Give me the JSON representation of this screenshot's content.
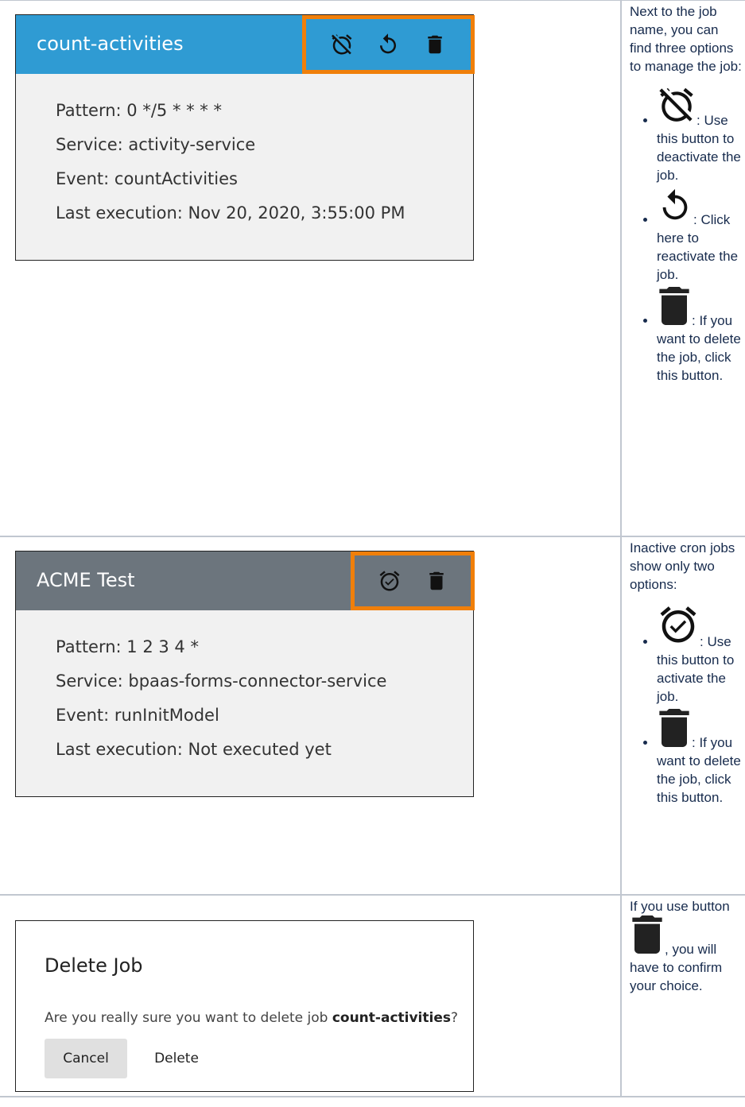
{
  "job1": {
    "name": "count-activities",
    "header_color": "#2f9bd3",
    "lines": [
      "Pattern: 0 */5 * * * *",
      "Service: activity-service",
      "Event: countActivities",
      "Last execution: Nov 20, 2020, 3:55:00 PM"
    ],
    "icons": [
      "alarm-off-icon",
      "restore-icon",
      "delete-icon"
    ]
  },
  "desc1": {
    "intro": "Next to the job name, you can find three options to manage the job:",
    "items": [
      ": Use this button to deactivate the job.",
      ": Click here to reactivate the job.",
      ": If you want to delete the job, click this button."
    ]
  },
  "job2": {
    "name": "ACME Test",
    "header_color": "#6c757d",
    "lines": [
      "Pattern: 1 2 3 4 *",
      "Service: bpaas-forms-connector-service",
      "Event: runInitModel",
      "Last execution: Not executed yet"
    ],
    "icons": [
      "alarm-check-icon",
      "delete-icon"
    ]
  },
  "desc2": {
    "intro": "Inactive cron jobs show only two options:",
    "items": [
      ": Use this button to activate the job.",
      ": If you want to delete the job, click this button."
    ]
  },
  "dialog": {
    "title": "Delete Job",
    "message_prefix": "Are you really sure you want to delete job ",
    "job_name": "count-activities",
    "message_suffix": "?",
    "cancel_label": "Cancel",
    "delete_label": "Delete"
  },
  "desc3": {
    "prefix": "If you use button ",
    "suffix": ", you will have to confirm your choice."
  },
  "colors": {
    "highlight": "#f07f0a",
    "border": "#c1c7d0"
  }
}
